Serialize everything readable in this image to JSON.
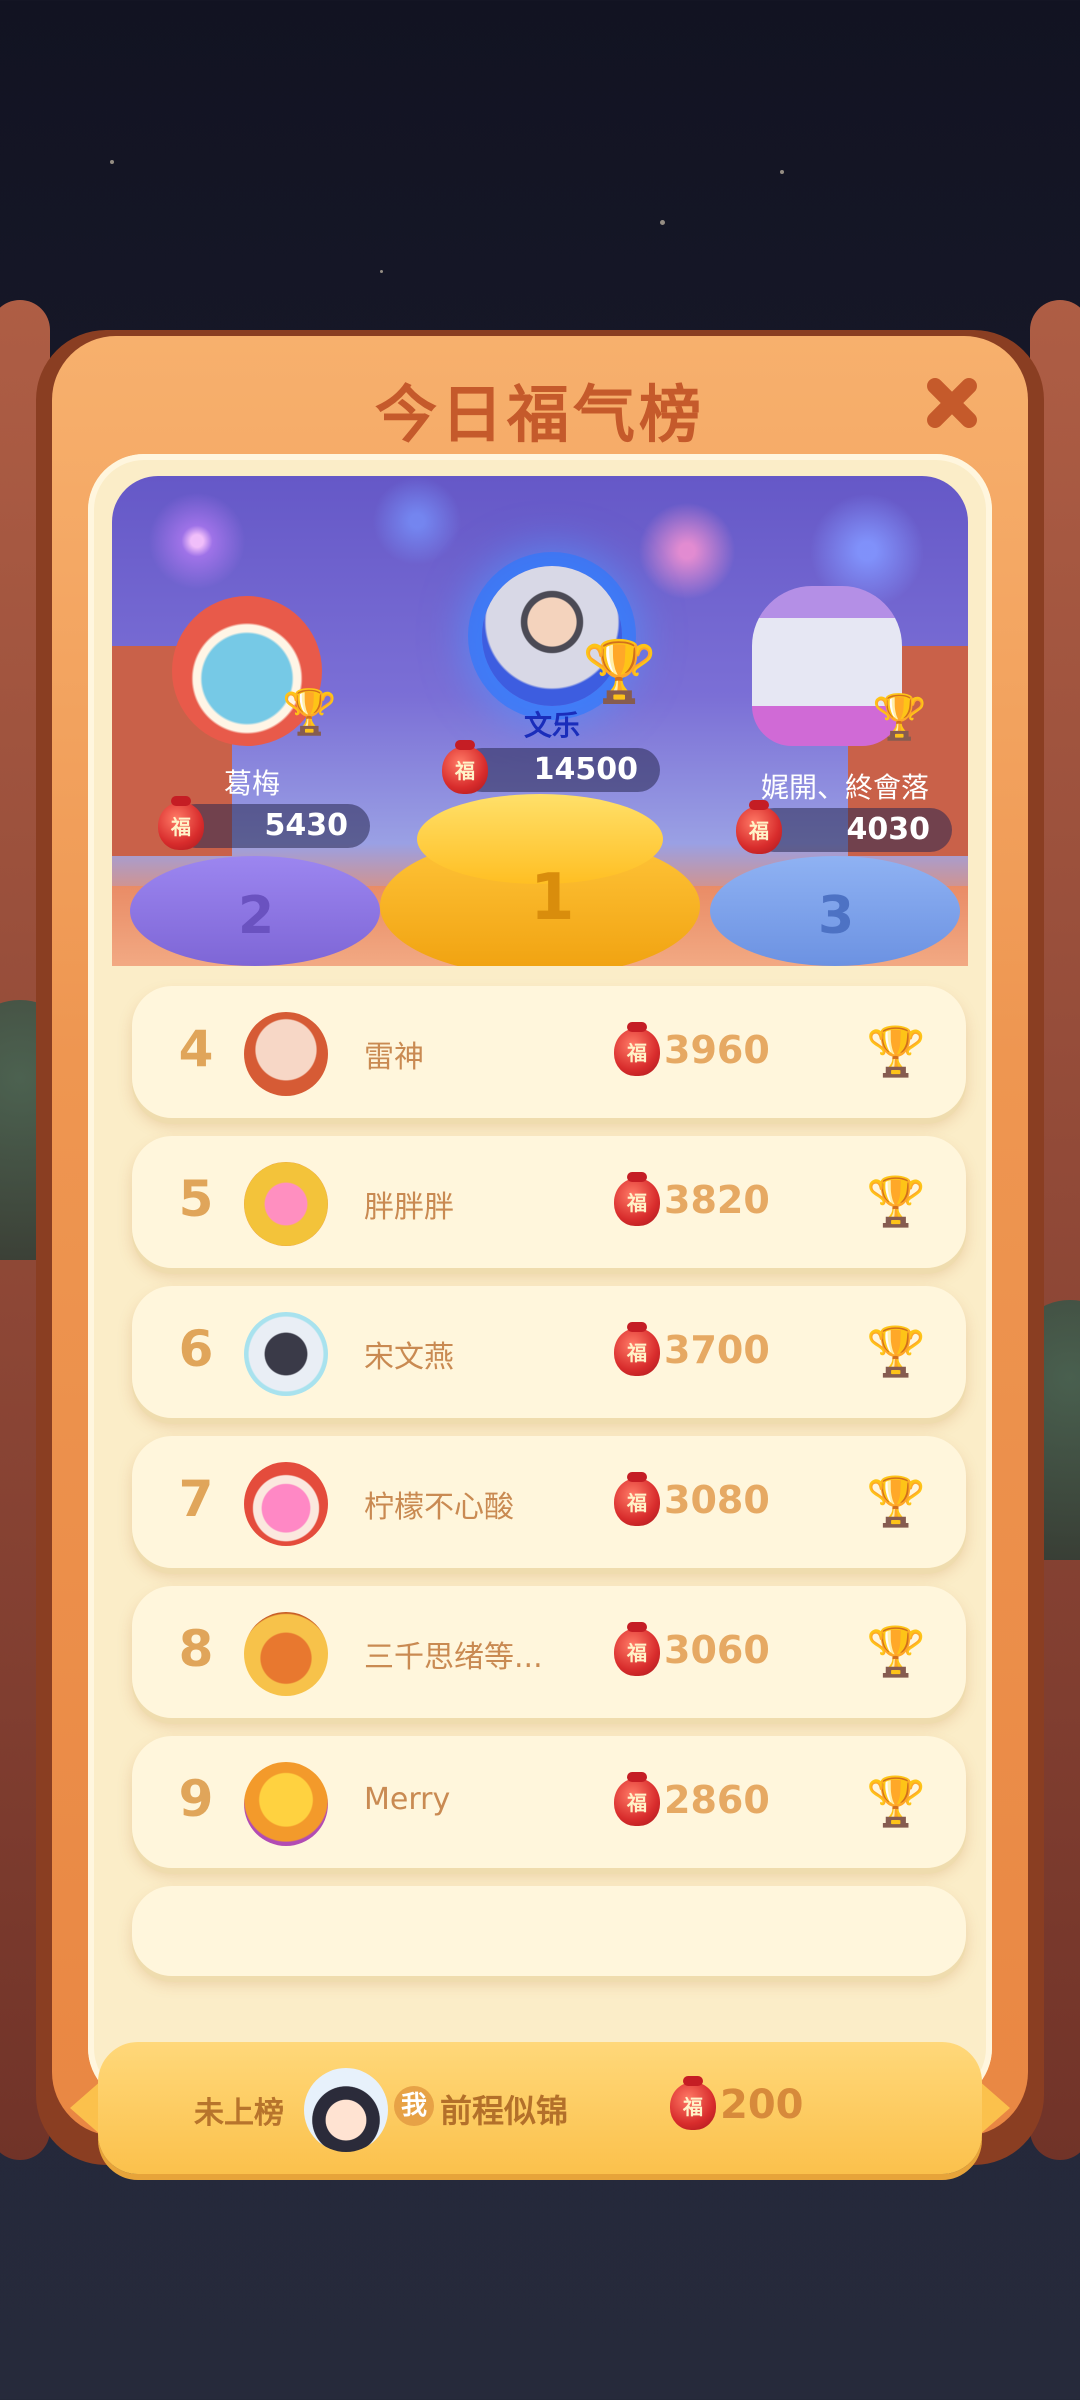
{
  "modal": {
    "title": "今日福气榜"
  },
  "top3": [
    {
      "rank": "1",
      "name": "文乐",
      "score": "14500"
    },
    {
      "rank": "2",
      "name": "葛梅",
      "score": "5430"
    },
    {
      "rank": "3",
      "name": "娓開、終會落",
      "score": "4030"
    }
  ],
  "ranks": [
    {
      "rank": "4",
      "name": "雷神",
      "score": "3960"
    },
    {
      "rank": "5",
      "name": "胖胖胖",
      "score": "3820"
    },
    {
      "rank": "6",
      "name": "宋文燕",
      "score": "3700"
    },
    {
      "rank": "7",
      "name": "柠檬不心酸",
      "score": "3080"
    },
    {
      "rank": "8",
      "name": "三千思绪等...",
      "score": "3060"
    },
    {
      "rank": "9",
      "name": "Merry",
      "score": "2860"
    }
  ],
  "fu_label": "福",
  "me": {
    "status": "未上榜",
    "badge": "我",
    "name": "前程似锦",
    "score": "200"
  },
  "colors": {
    "accent": "#c55a2b",
    "panel": "#fbedc8",
    "row": "#fff6dc",
    "my_bar": "#fbc14c"
  },
  "icons": {
    "close": "close-icon",
    "trophy": "trophy-icon",
    "bag": "lucky-bag-icon"
  }
}
